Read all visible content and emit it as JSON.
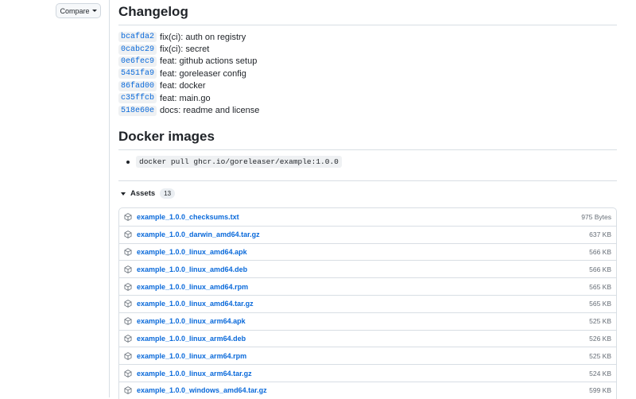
{
  "sidebar": {
    "compare_label": "Compare"
  },
  "changelog": {
    "title": "Changelog",
    "commits": [
      {
        "sha": "bcafda2",
        "message": "fix(ci): auth on registry"
      },
      {
        "sha": "0cabc29",
        "message": "fix(ci): secret"
      },
      {
        "sha": "0e6fec9",
        "message": "feat: github actions setup"
      },
      {
        "sha": "5451fa9",
        "message": "feat: goreleaser config"
      },
      {
        "sha": "86fad00",
        "message": "feat: docker"
      },
      {
        "sha": "c35ffcb",
        "message": "feat: main.go"
      },
      {
        "sha": "518e60e",
        "message": "docs: readme and license"
      }
    ]
  },
  "docker": {
    "title": "Docker images",
    "command": "docker pull ghcr.io/goreleaser/example:1.0.0"
  },
  "assets": {
    "label": "Assets",
    "count": "13",
    "items": [
      {
        "name": "example_1.0.0_checksums.txt",
        "size": "975 Bytes"
      },
      {
        "name": "example_1.0.0_darwin_amd64.tar.gz",
        "size": "637 KB"
      },
      {
        "name": "example_1.0.0_linux_amd64.apk",
        "size": "566 KB"
      },
      {
        "name": "example_1.0.0_linux_amd64.deb",
        "size": "566 KB"
      },
      {
        "name": "example_1.0.0_linux_amd64.rpm",
        "size": "565 KB"
      },
      {
        "name": "example_1.0.0_linux_amd64.tar.gz",
        "size": "565 KB"
      },
      {
        "name": "example_1.0.0_linux_arm64.apk",
        "size": "525 KB"
      },
      {
        "name": "example_1.0.0_linux_arm64.deb",
        "size": "526 KB"
      },
      {
        "name": "example_1.0.0_linux_arm64.rpm",
        "size": "525 KB"
      },
      {
        "name": "example_1.0.0_linux_arm64.tar.gz",
        "size": "524 KB"
      },
      {
        "name": "example_1.0.0_windows_amd64.tar.gz",
        "size": "599 KB"
      }
    ]
  }
}
